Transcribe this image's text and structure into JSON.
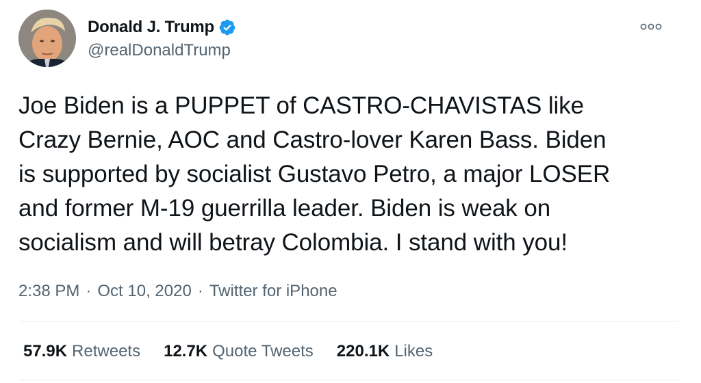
{
  "author": {
    "display_name": "Donald J. Trump",
    "handle": "@realDonaldTrump",
    "verified": true,
    "verified_icon": "verified-badge-icon",
    "verified_color": "#1d9bf0"
  },
  "tweet": {
    "text": "Joe Biden is a PUPPET of CASTRO-CHAVISTAS like\nCrazy Bernie, AOC and Castro-lover Karen Bass. Biden\nis supported by socialist Gustavo Petro, a major LOSER\nand former M-19 guerrilla leader. Biden is weak on\nsocialism and will betray Colombia. I stand with you!",
    "time": "2:38 PM",
    "separator": "·",
    "date": "Oct 10, 2020",
    "source": "Twitter for iPhone"
  },
  "stats": [
    {
      "count": "57.9K",
      "label": "Retweets"
    },
    {
      "count": "12.7K",
      "label": "Quote Tweets"
    },
    {
      "count": "220.1K",
      "label": "Likes"
    }
  ],
  "more_icon": "more-options-icon"
}
